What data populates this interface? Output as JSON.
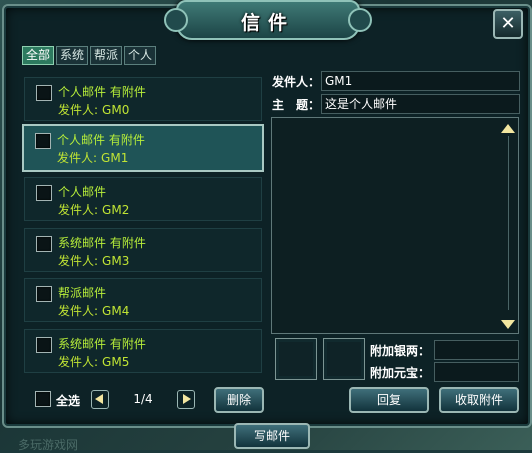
{
  "title": "信件",
  "tabs": [
    {
      "label": "全部",
      "active": true
    },
    {
      "label": "系统",
      "active": false
    },
    {
      "label": "帮派",
      "active": false
    },
    {
      "label": "个人",
      "active": false
    }
  ],
  "mails": [
    {
      "subject": "个人邮件 有附件",
      "sender_label": "发件人:",
      "sender": "GM0",
      "selected": false
    },
    {
      "subject": "个人邮件 有附件",
      "sender_label": "发件人:",
      "sender": "GM1",
      "selected": true
    },
    {
      "subject": "个人邮件",
      "sender_label": "发件人:",
      "sender": "GM2",
      "selected": false
    },
    {
      "subject": "系统邮件 有附件",
      "sender_label": "发件人:",
      "sender": "GM3",
      "selected": false
    },
    {
      "subject": "帮派邮件",
      "sender_label": "发件人:",
      "sender": "GM4",
      "selected": false
    },
    {
      "subject": "系统邮件 有附件",
      "sender_label": "发件人:",
      "sender": "GM5",
      "selected": false
    }
  ],
  "detail": {
    "sender_label": "发件人：",
    "sender_value": "GM1",
    "subject_label": "主　题：",
    "subject_value": "这是个人邮件",
    "body": ""
  },
  "attachments": {
    "silver_label": "附加银两：",
    "silver_value": "",
    "yuanbao_label": "附加元宝：",
    "yuanbao_value": ""
  },
  "footer": {
    "select_all_label": "全选",
    "page_indicator": "1/4",
    "delete_label": "删除",
    "reply_label": "回复",
    "collect_label": "收取附件",
    "compose_label": "写邮件"
  },
  "watermark": "多玩游戏网",
  "colors": {
    "accent_green": "#b8ef3a",
    "frame_border": "#9bb7b4",
    "selected_row": "#1f5457"
  }
}
